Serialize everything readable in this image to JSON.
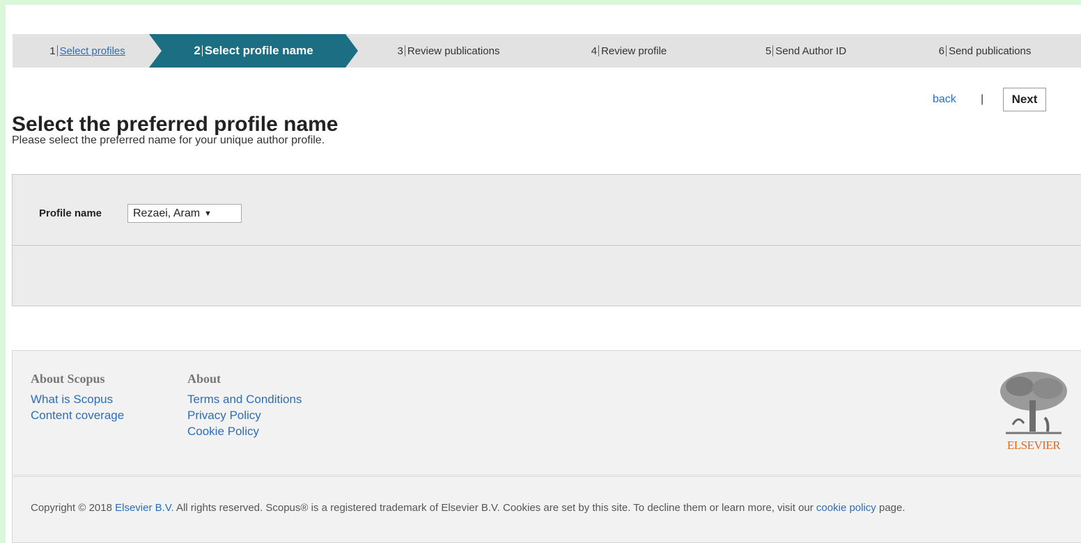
{
  "steps": [
    {
      "num": "1",
      "label": "Select profiles"
    },
    {
      "num": "2",
      "label": "Select profile name"
    },
    {
      "num": "3",
      "label": "Review publications"
    },
    {
      "num": "4",
      "label": "Review profile"
    },
    {
      "num": "5",
      "label": "Send Author ID"
    },
    {
      "num": "6",
      "label": "Send publications"
    }
  ],
  "main": {
    "title": "Select the preferred profile name",
    "subtitle": "Please select the preferred name for your unique author profile.",
    "field_label": "Profile name",
    "selected_name": "Rezaei, Aram",
    "back_label": "back",
    "separator": "|",
    "next_label": "Next"
  },
  "footer": {
    "col1": {
      "title": "About Scopus",
      "links": [
        "What is Scopus",
        "Content coverage"
      ]
    },
    "col2": {
      "title": "About",
      "links": [
        "Terms and Conditions",
        "Privacy Policy",
        "Cookie Policy"
      ]
    },
    "logo_text": "ELSEVIER",
    "copyright": {
      "part1": "Copyright © 2018 ",
      "link1": "Elsevier B.V.",
      "part2": " All rights reserved. Scopus® is a registered trademark of Elsevier B.V. Cookies are set by this site. To decline them or learn more, visit our ",
      "link2": "cookie policy",
      "part3": " page."
    }
  },
  "colors": {
    "active_step": "#1c6f82",
    "link": "#2a6ebb",
    "elsevier_orange": "#e36a1d"
  }
}
